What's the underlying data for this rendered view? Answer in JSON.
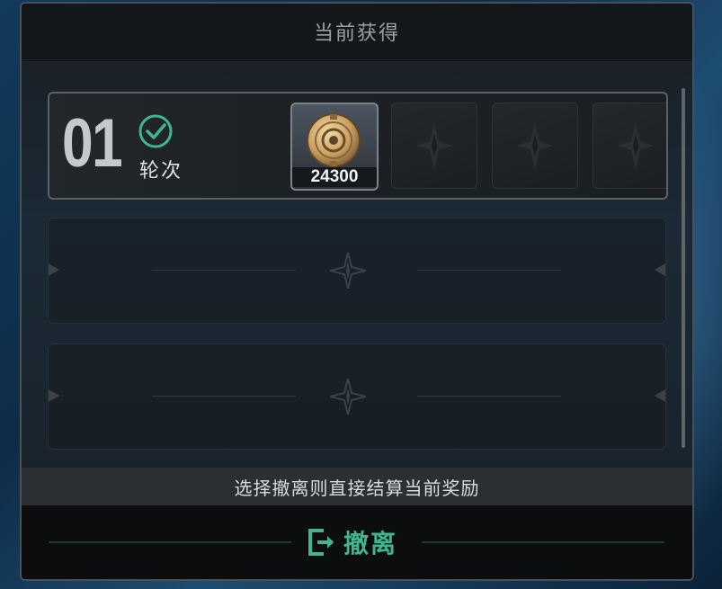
{
  "panel": {
    "title": "当前获得"
  },
  "round": {
    "number": "01",
    "label": "轮次",
    "status": "completed",
    "rewards": [
      {
        "item": "coin",
        "count": "24300"
      },
      {
        "item": "empty"
      },
      {
        "item": "empty"
      },
      {
        "item": "empty"
      }
    ]
  },
  "empty_rounds": 2,
  "notice": "选择撤离则直接结算当前奖励",
  "action": {
    "retreat_label": "撤离",
    "retreat_icon": "exit-icon"
  },
  "colors": {
    "accent": "#3fb690",
    "panel_bg": "#111417"
  }
}
